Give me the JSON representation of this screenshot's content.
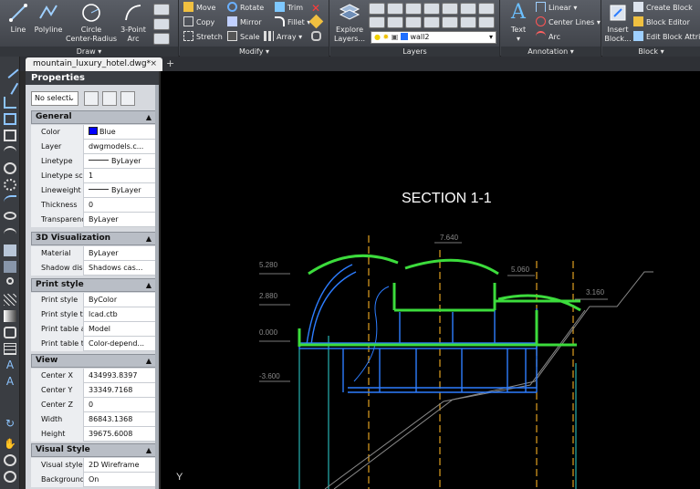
{
  "ribbon": {
    "draw": {
      "title": "Draw",
      "line": "Line",
      "polyline": "Polyline",
      "circle": "Circle",
      "circle_sub": "Center-Radius",
      "arc": "3-Point",
      "arc_sub": "Arc"
    },
    "modify": {
      "title": "Modify",
      "move": "Move",
      "rotate": "Rotate",
      "trim": "Trim",
      "copy": "Copy",
      "mirror": "Mirror",
      "fillet": "Fillet",
      "stretch": "Stretch",
      "scale": "Scale",
      "array": "Array"
    },
    "layers": {
      "title": "Layers",
      "explore": "Explore",
      "explore_sub": "Layers...",
      "current_layer": "wall2"
    },
    "annotation": {
      "title": "Annotation",
      "text": "Text",
      "linear": "Linear",
      "center_lines": "Center Lines",
      "arc": "Arc"
    },
    "block": {
      "title": "Block",
      "insert": "Insert",
      "insert_sub": "Block...",
      "create": "Create Block",
      "editor": "Block Editor",
      "edit_attrib": "Edit Block Attrib"
    }
  },
  "tab": {
    "filename": "mountain_luxury_hotel.dwg*",
    "close": "×",
    "new": "+"
  },
  "properties": {
    "title": "Properties",
    "selection": "No selecti",
    "sections": {
      "general": "General",
      "viz": "3D Visualization",
      "plot": "Print style",
      "view": "View",
      "visual": "Visual Style"
    },
    "general": [
      {
        "k": "Color",
        "v": "Blue"
      },
      {
        "k": "Layer",
        "v": "dwgmodels.c..."
      },
      {
        "k": "Linetype",
        "v": "ByLayer"
      },
      {
        "k": "Linetype scale",
        "v": "1"
      },
      {
        "k": "Lineweight",
        "v": "ByLayer"
      },
      {
        "k": "Thickness",
        "v": "0"
      },
      {
        "k": "Transparency",
        "v": "ByLayer"
      }
    ],
    "viz": [
      {
        "k": "Material",
        "v": "ByLayer"
      },
      {
        "k": "Shadow displ...",
        "v": "Shadows cas..."
      }
    ],
    "plot": [
      {
        "k": "Print style",
        "v": "ByColor"
      },
      {
        "k": "Print style table",
        "v": "lcad.ctb"
      },
      {
        "k": "Print table att...",
        "v": "Model"
      },
      {
        "k": "Print table type",
        "v": "Color-depend..."
      }
    ],
    "view": [
      {
        "k": "Center X",
        "v": "434993.8397"
      },
      {
        "k": "Center Y",
        "v": "33349.7168"
      },
      {
        "k": "Center Z",
        "v": "0"
      },
      {
        "k": "Width",
        "v": "86843.1368"
      },
      {
        "k": "Height",
        "v": "39675.6008"
      }
    ],
    "visual": [
      {
        "k": "Visual style",
        "v": "2D Wireframe"
      },
      {
        "k": "Background",
        "v": "On"
      }
    ]
  },
  "canvas": {
    "title": "SECTION 1-1",
    "axis_label": "Y",
    "levels": [
      "5.280",
      "2.880",
      "0.000",
      "-3.600",
      "7.640",
      "5.060",
      "3.160"
    ]
  },
  "colors": {
    "accent_green": "#3cdc3c",
    "accent_blue": "#2d7dff",
    "axis_orange": "#e0a020",
    "cyan": "#2ed6d6"
  }
}
